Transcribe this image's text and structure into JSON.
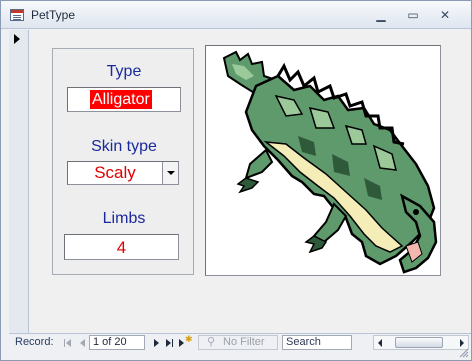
{
  "window": {
    "title": "PetType",
    "minimize_glyph": "▁",
    "maximize_glyph": "▭",
    "close_glyph": "✕"
  },
  "form": {
    "type_label": "Type",
    "type_value": "Alligator",
    "skin_label": "Skin type",
    "skin_value": "Scaly",
    "limbs_label": "Limbs",
    "limbs_value": "4",
    "image_subject": "alligator clipart"
  },
  "navigation": {
    "record_label": "Record:",
    "record_position": "1 of 20",
    "filter_label": "No Filter",
    "search_placeholder": "Search"
  },
  "colors": {
    "label_blue": "#1a2a9c",
    "value_red": "#e00000",
    "highlight_red": "#ff0000"
  }
}
